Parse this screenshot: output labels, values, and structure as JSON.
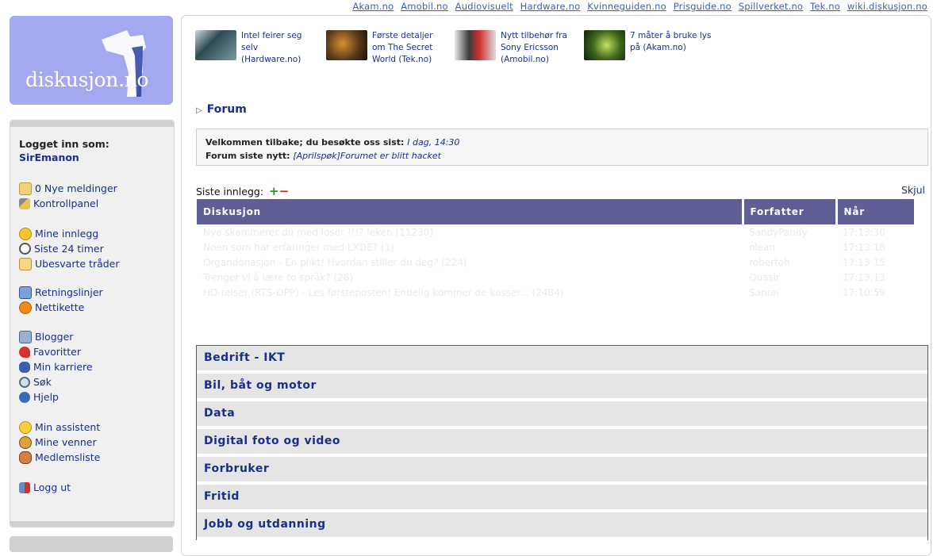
{
  "top_links": [
    "Akam.no",
    "Amobil.no",
    "Audiovisuelt",
    "Hardware.no",
    "Kvinneguiden.no",
    "Prisguide.no",
    "Spillverket.no",
    "Tek.no",
    "wiki.diskusjon.no"
  ],
  "logo": {
    "text": "diskusjon.no"
  },
  "sidebar": {
    "login_label": "Logget inn som:",
    "username": "SirEmanon",
    "groups": [
      [
        {
          "label": "0 Nye meldinger",
          "icon": "mailbox-icon"
        },
        {
          "label": "Kontrollpanel",
          "icon": "tools-icon"
        }
      ],
      [
        {
          "label": "Mine innlegg",
          "icon": "smiley-icon"
        },
        {
          "label": "Siste 24 timer",
          "icon": "clock-icon"
        },
        {
          "label": "Ubesvarte tråder",
          "icon": "envelope-icon"
        }
      ],
      [
        {
          "label": "Retningslinjer",
          "icon": "document-icon"
        },
        {
          "label": "Nettikette",
          "icon": "warning-icon"
        }
      ],
      [
        {
          "label": "Blogger",
          "icon": "blog-icon"
        },
        {
          "label": "Favoritter",
          "icon": "heart-icon"
        },
        {
          "label": "Min karriere",
          "icon": "footsteps-icon"
        },
        {
          "label": "Søk",
          "icon": "magnifier-icon"
        },
        {
          "label": "Hjelp",
          "icon": "help-icon"
        }
      ],
      [
        {
          "label": "Min assistent",
          "icon": "assistant-icon"
        },
        {
          "label": "Mine venner",
          "icon": "friends-icon"
        },
        {
          "label": "Medlemsliste",
          "icon": "members-icon"
        }
      ],
      [
        {
          "label": "Logg ut",
          "icon": "logout-icon"
        }
      ]
    ]
  },
  "news": [
    {
      "text": "Intel feirer seg selv (Hardware.no)",
      "thumb_color": "#2e4a52"
    },
    {
      "text": "Første detaljer om The Secret World (Tek.no)",
      "thumb_color": "#5a3a1a"
    },
    {
      "text": "Nytt tilbehør fra Sony Ericsson (Amobil.no)",
      "thumb_color": "#3a3a3a"
    },
    {
      "text": "7 måter å bruke lys på (Akam.no)",
      "thumb_color": "#3f6a1e"
    }
  ],
  "breadcrumb": {
    "label": "Forum"
  },
  "welcome": {
    "line1_label": "Velkommen tilbake; du besøkte oss sist:",
    "line1_value": "I dag, 14:30",
    "line2_label": "Forum siste nytt:",
    "line2_value": "[Aprilspøk]Forumet er blitt hacket"
  },
  "latest": {
    "label": "Siste innlegg:",
    "plus": "+",
    "minus": "−",
    "hide_label": "Skjul",
    "headers": [
      "Diskusjon",
      "Forfatter",
      "Når"
    ],
    "rows": [
      {
        "title": "Nye skammerer du med loser !!!? leken (11230)",
        "author": "SandyPandy",
        "time": "17:13:30"
      },
      {
        "title": "Noen som har erfaringer med LXDE? (1)",
        "author": "olean",
        "time": "17:13:18"
      },
      {
        "title": "Organdonasjon - En plikt! Hvordan stiller du deg? (224)",
        "author": "robertoh",
        "time": "17:13:15"
      },
      {
        "title": "Trenger vi å lære to språk? (28)",
        "author": "Quasir",
        "time": "17:13:13"
      },
      {
        "title": "HD-reiser (RTS-OPP) - Les førsteposten! Endelig kommer de kasser... (2484)",
        "author": "Sanrei",
        "time": "17:10:59"
      }
    ]
  },
  "categories": [
    "Bedrift - IKT",
    "Bil, båt og motor",
    "Data",
    "Digital foto og video",
    "Forbruker",
    "Fritid",
    "Jobb og utdanning"
  ]
}
